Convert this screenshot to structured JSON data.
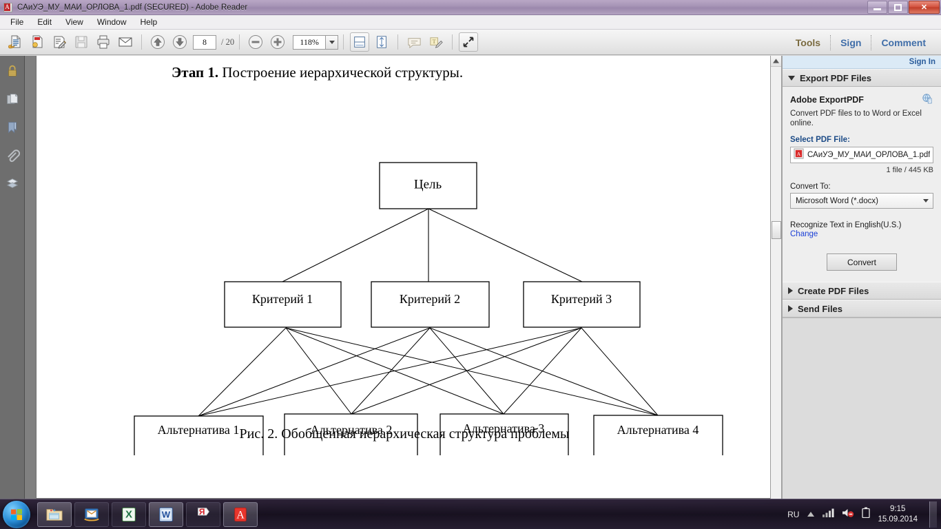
{
  "window": {
    "title": "САиУЭ_МУ_МАИ_ОРЛОВА_1.pdf (SECURED) - Adobe Reader",
    "icon": "pdf-document-icon",
    "minimize_label": "Minimize",
    "restore_label": "Restore",
    "close_label": "✕"
  },
  "menu": {
    "items": [
      {
        "label": "File"
      },
      {
        "label": "Edit"
      },
      {
        "label": "View"
      },
      {
        "label": "Window"
      },
      {
        "label": "Help"
      }
    ]
  },
  "toolbar": {
    "icons": [
      {
        "name": "open-file-icon",
        "title": "Open"
      },
      {
        "name": "create-pdf-icon",
        "title": "Create PDF"
      },
      {
        "name": "sign-document-icon",
        "title": "Sign"
      },
      {
        "name": "save-icon",
        "title": "Save"
      },
      {
        "name": "print-icon",
        "title": "Print"
      },
      {
        "name": "email-icon",
        "title": "Email"
      }
    ],
    "prev_page_label": "Previous Page",
    "next_page_label": "Next Page",
    "current_page": "8",
    "page_total": "/ 20",
    "zoom_out_label": "Zoom Out",
    "zoom_in_label": "Zoom In",
    "zoom_value": "118%",
    "fit_width_label": "Fit Width",
    "fit_page_label": "Fit Page",
    "comment_label": "Add Sticky Note",
    "text_comment_label": "Add Text Comment",
    "fullscreen_label": "Read Mode",
    "right_links": [
      {
        "label": "Tools",
        "color": "#7a6a3f"
      },
      {
        "label": "Sign",
        "color": "#3f6da8"
      },
      {
        "label": "Comment",
        "color": "#3f6da8"
      }
    ]
  },
  "left_rail": {
    "items": [
      {
        "name": "security-lock-icon",
        "label": "Security"
      },
      {
        "name": "page-thumbnails-icon",
        "label": "Page Thumbnails"
      },
      {
        "name": "bookmarks-icon",
        "label": "Bookmarks"
      },
      {
        "name": "attachments-paperclip-icon",
        "label": "Attachments"
      },
      {
        "name": "layers-icon",
        "label": "Layers"
      }
    ]
  },
  "document": {
    "heading_bold": "Этап 1.",
    "heading_rest": " Построение иерархической структуры.",
    "caption": "Рис. 2.  Обобщенная иерархическая структура проблемы",
    "diagram": {
      "goal": {
        "label": "Цель"
      },
      "criteria": [
        {
          "label": "Критерий 1"
        },
        {
          "label": "Критерий 2"
        },
        {
          "label": "Критерий 3"
        }
      ],
      "alternatives": [
        {
          "label": "Альтернатива 1"
        },
        {
          "label": "Альтернатива 2"
        },
        {
          "label": "Альтернатива 3"
        },
        {
          "label": "Альтернатива 4"
        }
      ]
    }
  },
  "right_panel": {
    "sign_in": "Sign In",
    "sections": [
      {
        "title": "Export PDF Files",
        "expanded": true
      },
      {
        "title": "Create PDF Files",
        "expanded": false
      },
      {
        "title": "Send Files",
        "expanded": false
      }
    ],
    "export": {
      "product": "Adobe ExportPDF",
      "description": "Convert PDF files to to Word or Excel online.",
      "select_label": "Select PDF File:",
      "file_name": "САиУЭ_МУ_МАИ_ОРЛОВА_1.pdf",
      "file_meta": "1 file / 445 KB",
      "convert_to_label": "Convert To:",
      "convert_to_value": "Microsoft Word (*.docx)",
      "recognize_text": "Recognize Text in English(U.S.)",
      "change_link": "Change",
      "convert_button": "Convert"
    }
  },
  "taskbar": {
    "start_label": "Start",
    "items": [
      {
        "name": "taskbar-explorer",
        "label": "Windows Explorer"
      },
      {
        "name": "taskbar-mail",
        "label": "Mail"
      },
      {
        "name": "taskbar-excel",
        "label": "Microsoft Excel"
      },
      {
        "name": "taskbar-word",
        "label": "Microsoft Word"
      },
      {
        "name": "taskbar-yandex",
        "label": "Yandex Browser"
      },
      {
        "name": "taskbar-adobe-reader",
        "label": "Adobe Reader"
      }
    ],
    "tray": {
      "language": "RU",
      "show_hidden_label": "Show hidden icons",
      "network_label": "Network",
      "volume_label": "Volume (muted)",
      "battery_label": "Battery",
      "time": "9:15",
      "date": "15.09.2014"
    }
  },
  "colors": {
    "accent_blue": "#3f6da8",
    "link_blue": "#1a3fd6",
    "panel_bg": "#eeeeee",
    "titlebar": "#a795b6"
  }
}
